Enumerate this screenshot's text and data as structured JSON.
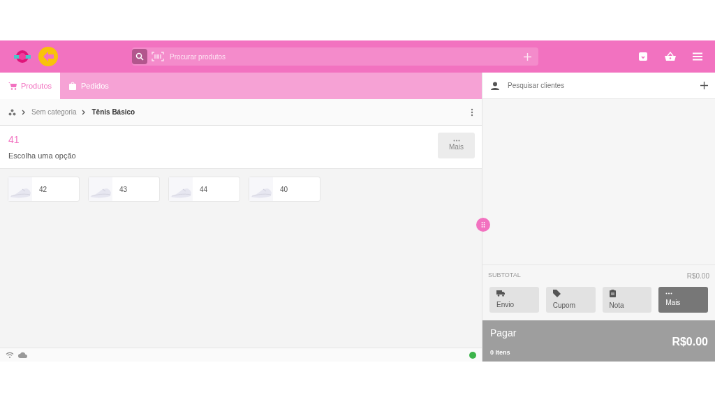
{
  "search": {
    "placeholder": "Procurar produtos"
  },
  "tabs": [
    {
      "label": "Produtos",
      "selected": true,
      "kind": "cart"
    },
    {
      "label": "Pedidos",
      "selected": false,
      "kind": "bag"
    }
  ],
  "breadcrumb": [
    "Sem categoria",
    "Tênis Básico"
  ],
  "product": {
    "title": "41",
    "subtitle": "Escolha uma opção",
    "more_button": "Mais"
  },
  "variants": [
    {
      "label": "42"
    },
    {
      "label": "43"
    },
    {
      "label": "44"
    },
    {
      "label": "40"
    }
  ],
  "status_bar": {
    "connected": true
  },
  "customer": {
    "placeholder": "Pesquisar clientes"
  },
  "subtotal": {
    "label": "SUBTOTAL",
    "value": "R$0.00"
  },
  "actions": [
    {
      "label": "Envio",
      "kind": "truck",
      "selected": false
    },
    {
      "label": "Cupom",
      "kind": "tag",
      "selected": false
    },
    {
      "label": "Nota",
      "kind": "clipboard",
      "selected": false
    },
    {
      "label": "Mais",
      "kind": "dots",
      "selected": true
    }
  ],
  "pay": {
    "label": "Pagar",
    "total": "R$0.00",
    "count": "0 Itens"
  }
}
